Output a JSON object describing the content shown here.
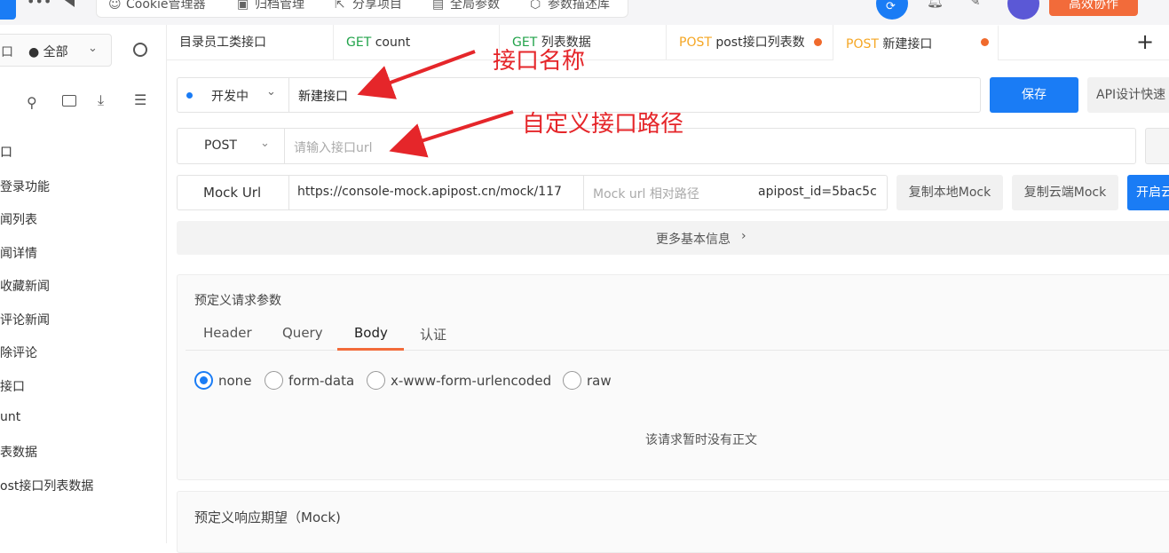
{
  "topbar": {
    "cookie_label": "Cookie管理器",
    "docs_label": "归档管理",
    "share_label": "分享项目",
    "global_label": "全局参数",
    "params_label": "参数描述库",
    "collab_label": "高效协作"
  },
  "sidebar": {
    "filter_left": "口",
    "filter_scope": "● 全部",
    "items": [
      "口",
      "登录功能",
      "闻列表",
      "闻详情",
      "收藏新闻",
      "评论新闻",
      "除评论",
      "接口",
      "unt",
      "表数据",
      "ost接口列表数据"
    ]
  },
  "tabs": [
    {
      "method": "",
      "label": "目录员工类接口"
    },
    {
      "method": "GET",
      "label": "count"
    },
    {
      "method": "GET",
      "label": "列表数据"
    },
    {
      "method": "POST",
      "label": "post接口列表数"
    },
    {
      "method": "POST",
      "label": "新建接口"
    }
  ],
  "form": {
    "status": "开发中",
    "api_name": "新建接口",
    "save_label": "保存",
    "api_design_label": "API设计快速",
    "method": "POST",
    "url_placeholder": "请输入接口url",
    "mock_label": "Mock Url",
    "mock_url": "https://console-mock.apipost.cn/mock/117",
    "mock_rel_placeholder": "Mock url 相对路径",
    "mock_query": "apipost_id=5bac5c",
    "copy_local_mock": "复制本地Mock",
    "copy_cloud_mock": "复制云端Mock",
    "open_cloud_label": "开启云"
  },
  "more_info": "更多基本信息",
  "request_section": {
    "title": "预定义请求参数",
    "tabs": [
      "Header",
      "Query",
      "Body",
      "认证"
    ],
    "active_tab": "Body",
    "body_options": [
      "none",
      "form-data",
      "x-www-form-urlencoded",
      "raw"
    ],
    "selected_option": "none",
    "empty_text": "该请求暂时没有正文"
  },
  "response_section": {
    "title": "预定义响应期望（Mock)"
  },
  "annotations": {
    "name_note": "接口名称",
    "path_note": "自定义接口路径"
  },
  "colors": {
    "accent": "#1a7cf5",
    "get": "#21a34a",
    "post": "#f5a623",
    "annotation": "#e5262a",
    "collab": "#f26b3a"
  }
}
